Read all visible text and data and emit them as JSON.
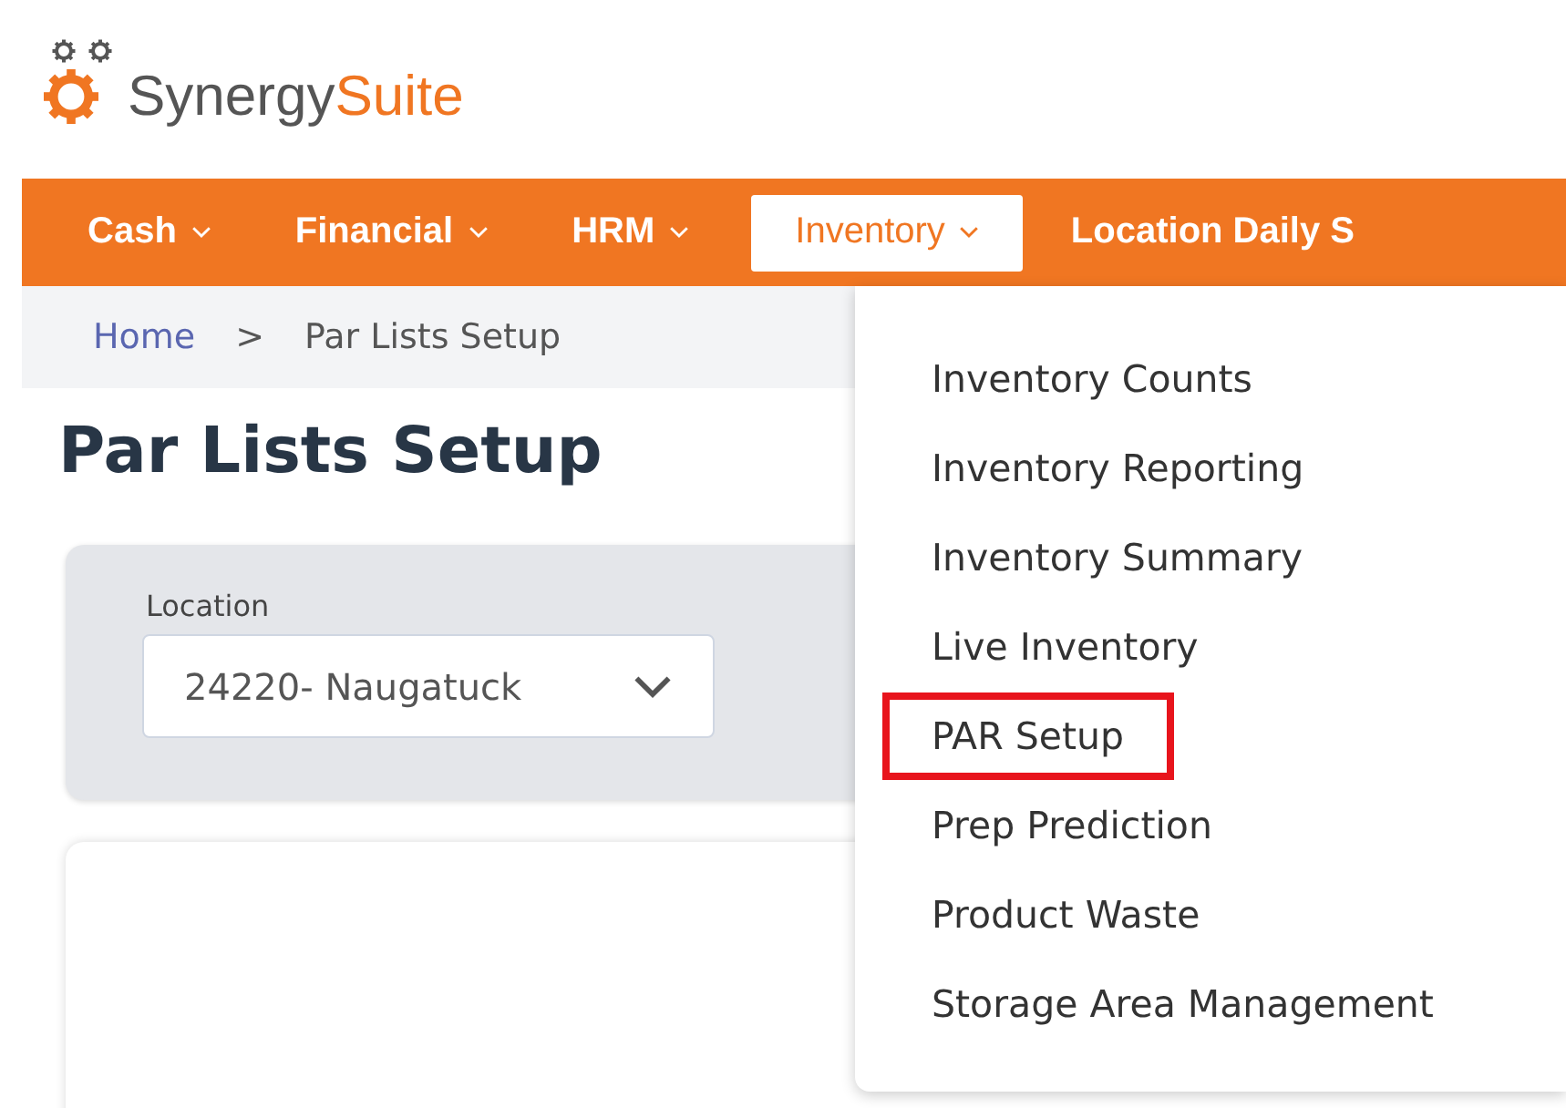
{
  "logo": {
    "word_1": "Synergy",
    "word_2": "Suite"
  },
  "nav": [
    {
      "label": "Cash",
      "dropdown": true,
      "selected": false
    },
    {
      "label": "Financial",
      "dropdown": true,
      "selected": false
    },
    {
      "label": "HRM",
      "dropdown": true,
      "selected": false
    },
    {
      "label": "Inventory",
      "dropdown": true,
      "selected": true
    },
    {
      "label": "Location Daily S",
      "dropdown": false,
      "selected": false
    }
  ],
  "breadcrumb": {
    "items": [
      "Home",
      "Par Lists Setup"
    ],
    "separator": ">"
  },
  "page_title": "Par Lists Setup",
  "filter": {
    "label": "Location",
    "value": "24220- Naugatuck"
  },
  "menu": [
    {
      "label": "Inventory Counts",
      "highlighted": false
    },
    {
      "label": "Inventory Reporting",
      "highlighted": false
    },
    {
      "label": "Inventory Summary",
      "highlighted": false
    },
    {
      "label": "Live Inventory",
      "highlighted": false
    },
    {
      "label": "PAR Setup",
      "highlighted": true
    },
    {
      "label": "Prep Prediction",
      "highlighted": false
    },
    {
      "label": "Product Waste",
      "highlighted": false
    },
    {
      "label": "Storage Area Management",
      "highlighted": false
    }
  ]
}
